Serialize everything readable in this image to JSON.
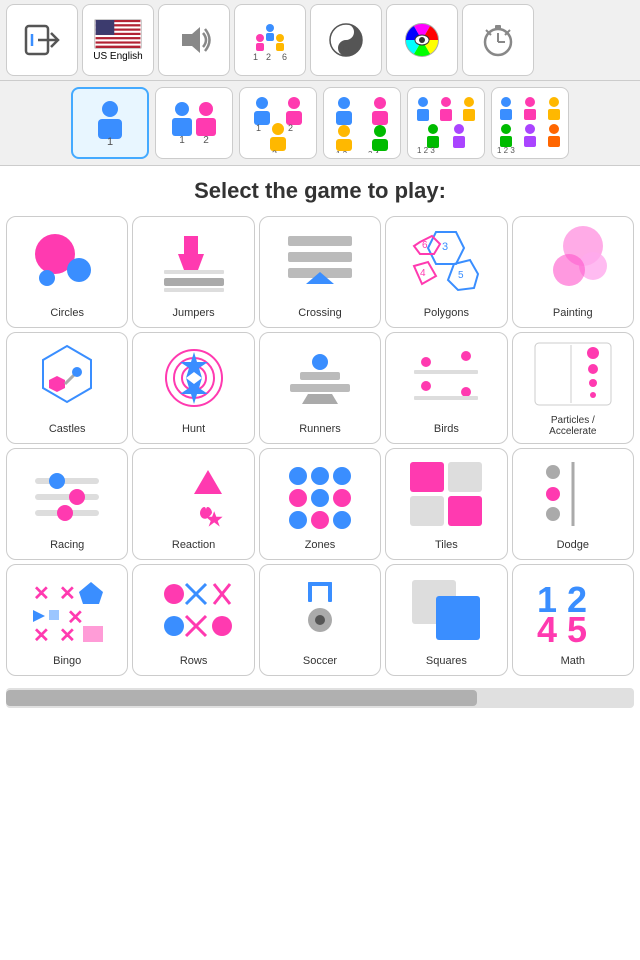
{
  "topbar": {
    "locale_label": "US English",
    "items": [
      {
        "name": "exit",
        "label": ""
      },
      {
        "name": "locale",
        "label": "US English"
      },
      {
        "name": "sound",
        "label": ""
      },
      {
        "name": "players-count",
        "label": ""
      },
      {
        "name": "yin-yang",
        "label": ""
      },
      {
        "name": "eye-color",
        "label": ""
      },
      {
        "name": "alarm",
        "label": ""
      }
    ]
  },
  "players": [
    {
      "id": 1,
      "label": "1"
    },
    {
      "id": 2,
      "label": "1-2"
    },
    {
      "id": 3,
      "label": "1-4"
    },
    {
      "id": 4,
      "label": "1-4"
    },
    {
      "id": 5,
      "label": "1-5"
    },
    {
      "id": 6,
      "label": "1-6"
    }
  ],
  "title": "Select the game to play:",
  "games": [
    {
      "id": "circles",
      "label": "Circles"
    },
    {
      "id": "jumpers",
      "label": "Jumpers"
    },
    {
      "id": "crossing",
      "label": "Crossing"
    },
    {
      "id": "polygons",
      "label": "Polygons"
    },
    {
      "id": "painting",
      "label": "Painting"
    },
    {
      "id": "castles",
      "label": "Castles"
    },
    {
      "id": "hunt",
      "label": "Hunt"
    },
    {
      "id": "runners",
      "label": "Runners"
    },
    {
      "id": "birds",
      "label": "Birds"
    },
    {
      "id": "particles",
      "label": "Particles / Accelerate"
    },
    {
      "id": "racing",
      "label": "Racing"
    },
    {
      "id": "reaction",
      "label": "Reaction"
    },
    {
      "id": "zones",
      "label": "Zones"
    },
    {
      "id": "tiles",
      "label": "Tiles"
    },
    {
      "id": "dodge",
      "label": "Dodge"
    },
    {
      "id": "bingo",
      "label": "Bingo"
    },
    {
      "id": "rows",
      "label": "Rows"
    },
    {
      "id": "soccer",
      "label": "Soccer"
    },
    {
      "id": "squares",
      "label": "Squares"
    },
    {
      "id": "math",
      "label": "Math"
    }
  ]
}
